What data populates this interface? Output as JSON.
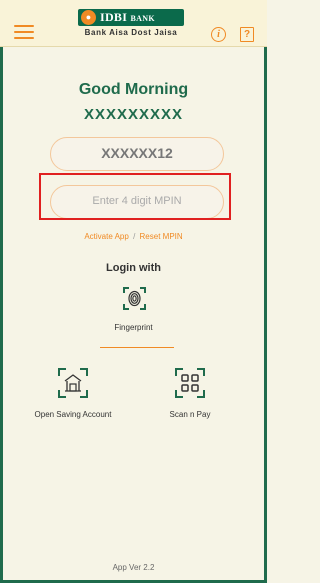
{
  "header": {
    "menu_icon": "hamburger-menu-icon",
    "logo_text": "IDBI",
    "logo_bank": "BANK",
    "tagline": "Bank Aisa Dost Jaisa",
    "info_icon": "info-icon",
    "help_icon": "help-icon",
    "info_glyph": "i",
    "help_glyph": "?"
  },
  "main": {
    "greeting": "Good Morning",
    "username": "XXXXXXXXX",
    "user_id_value": "XXXXXX12",
    "mpin_placeholder": "Enter 4 digit MPIN",
    "activate_link": "Activate App",
    "separator": "/",
    "reset_link": "Reset MPIN",
    "login_with": "Login with",
    "fingerprint_label": "Fingerprint"
  },
  "actions": {
    "open_account": "Open Saving Account",
    "scan_pay": "Scan n Pay"
  },
  "footer": {
    "version": "App Ver 2.2"
  },
  "colors": {
    "accent": "#f08a24",
    "brand_green": "#1f6b4c",
    "highlight": "#e02020"
  }
}
